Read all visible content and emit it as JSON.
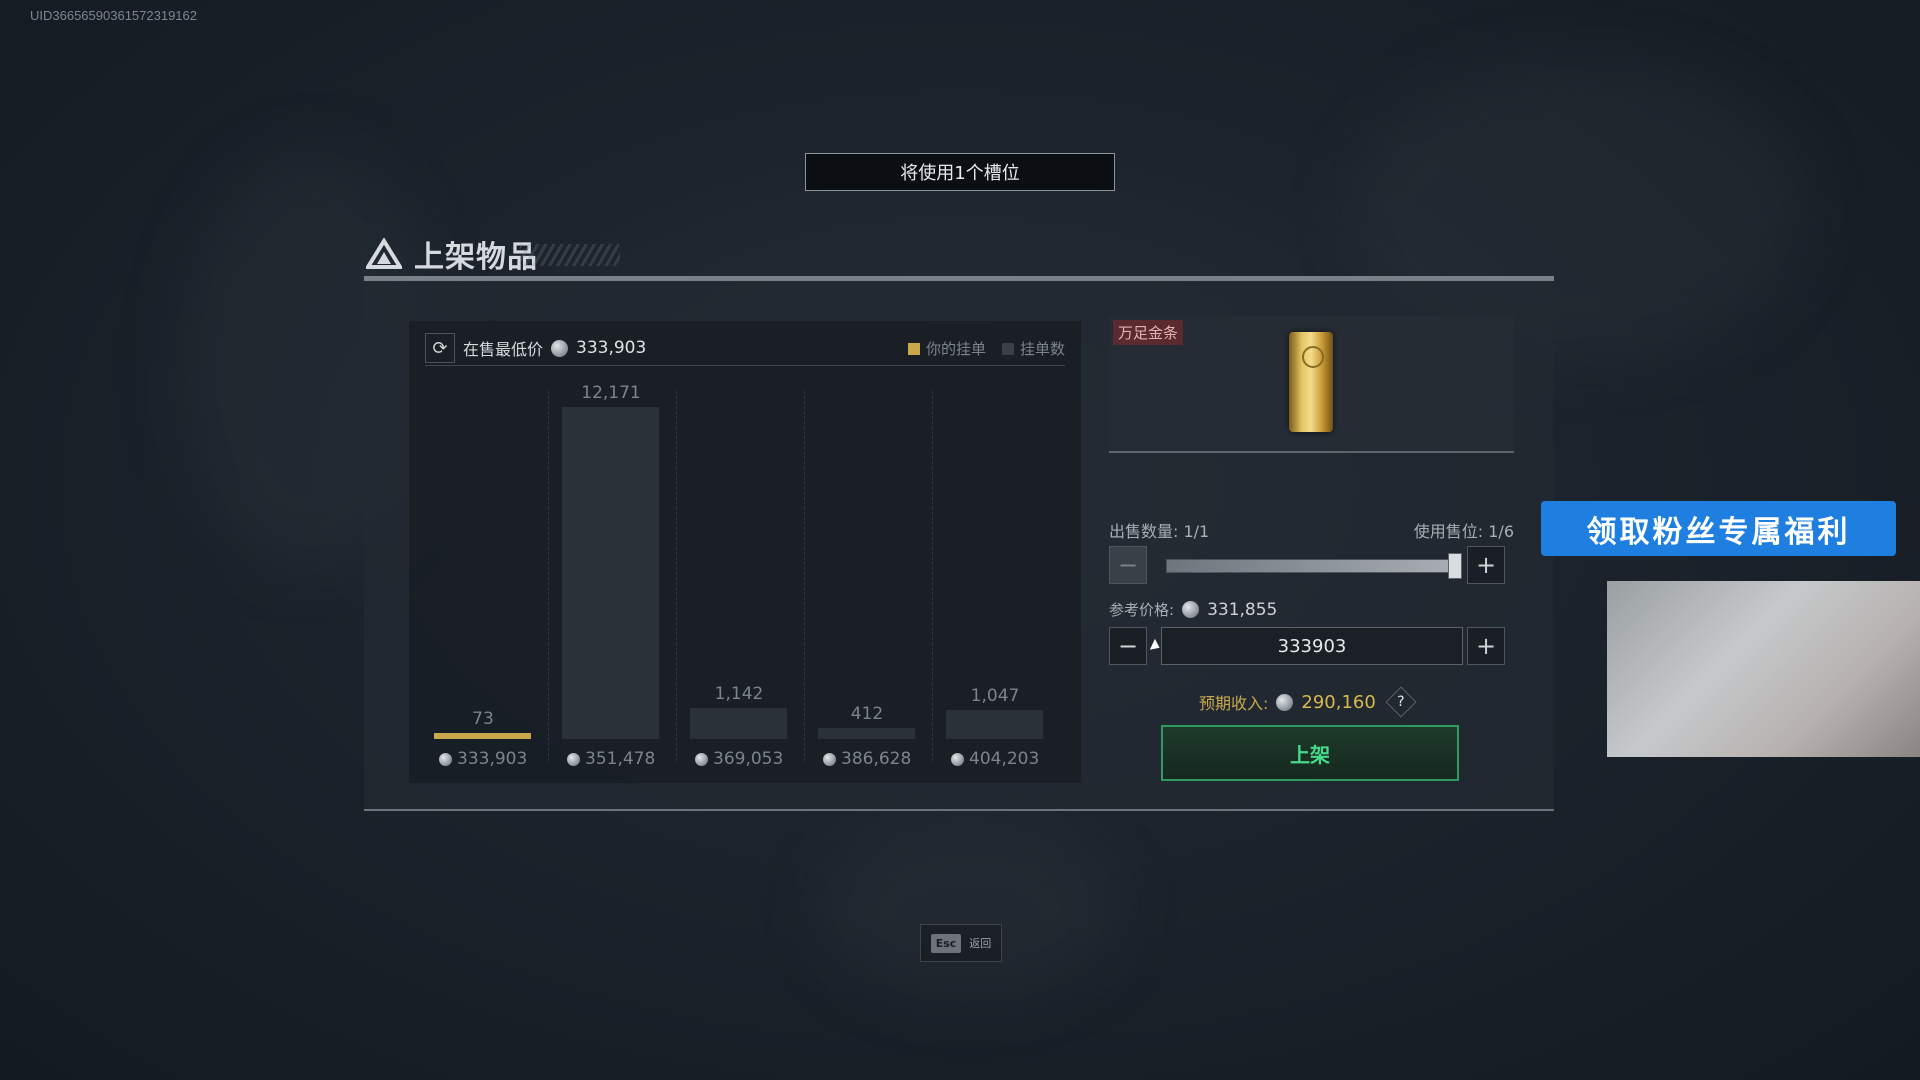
{
  "uid": "UID3665659036157231916​2",
  "slot_banner": "将使用1个槽位",
  "panel_title": "上架物品",
  "chart": {
    "min_price_label": "在售最低价",
    "min_price_value": "333,903",
    "legend_mine": "你的挂单",
    "legend_count": "挂单数",
    "bars": [
      {
        "count": "73",
        "price": "333,903"
      },
      {
        "count": "12,171",
        "price": "351,478"
      },
      {
        "count": "1,142",
        "price": "369,053"
      },
      {
        "count": "412",
        "price": "386,628"
      },
      {
        "count": "1,047",
        "price": "404,203"
      }
    ]
  },
  "chart_data": {
    "type": "bar",
    "categories": [
      "333,903",
      "351,478",
      "369,053",
      "386,628",
      "404,203"
    ],
    "values": [
      73,
      12171,
      1142,
      412,
      1047
    ],
    "title": "",
    "xlabel": "",
    "ylabel": ""
  },
  "item": {
    "tag": "万足金条"
  },
  "sell": {
    "qty_label": "出售数量: 1/1",
    "slot_label": "使用售位: 1/6",
    "ref_label": "参考价格:",
    "ref_value": "331,855",
    "price_input": "333903",
    "income_label": "预期收入:",
    "income_value": "290,160",
    "help": "?",
    "list_button": "上架",
    "minus": "−",
    "plus": "+",
    "slider_level": 1.0
  },
  "promo": "领取粉丝专属福利",
  "esc": {
    "key": "Esc",
    "text": "返回"
  },
  "colors": {
    "mine": "#c8a94a",
    "count": "#2b3139",
    "accent_green": "#46d98a",
    "promo_blue": "#1f7fe0"
  },
  "icons": {
    "refresh": "refresh-icon",
    "coin": "coin-icon",
    "title": "triangle-logo-icon"
  }
}
